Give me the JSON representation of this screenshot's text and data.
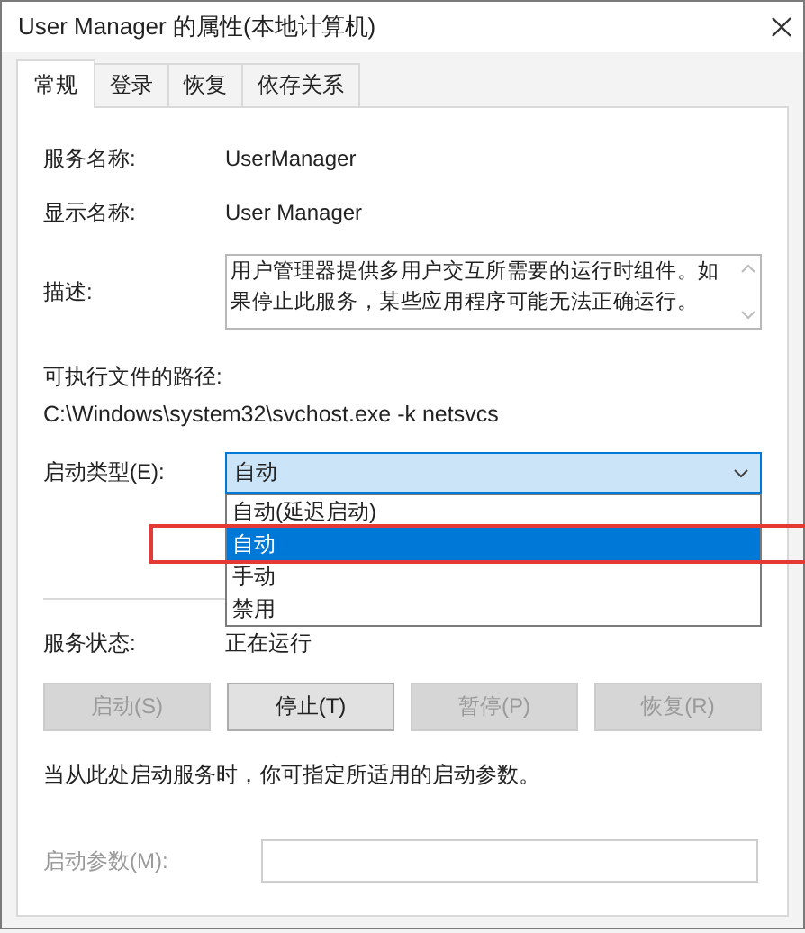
{
  "window": {
    "title": "User Manager 的属性(本地计算机)"
  },
  "tabs": [
    {
      "label": "常规",
      "selected": true
    },
    {
      "label": "登录",
      "selected": false
    },
    {
      "label": "恢复",
      "selected": false
    },
    {
      "label": "依存关系",
      "selected": false
    }
  ],
  "service_name": {
    "label": "服务名称:",
    "value": "UserManager"
  },
  "display_name": {
    "label": "显示名称:",
    "value": "User Manager"
  },
  "description": {
    "label": "描述:",
    "value": "用户管理器提供多用户交互所需要的运行时组件。如果停止此服务，某些应用程序可能无法正确运行。"
  },
  "executable_path": {
    "label": "可执行文件的路径:",
    "value": "C:\\Windows\\system32\\svchost.exe -k netsvcs"
  },
  "startup_type": {
    "label": "启动类型(E):",
    "value": "自动",
    "expanded": true,
    "options": [
      {
        "label": "自动(延迟启动)",
        "selected": false
      },
      {
        "label": "自动",
        "selected": true
      },
      {
        "label": "手动",
        "selected": false
      },
      {
        "label": "禁用",
        "selected": false
      }
    ]
  },
  "service_status": {
    "label": "服务状态:",
    "value": "正在运行"
  },
  "buttons": [
    {
      "label": "启动(S)",
      "disabled": true
    },
    {
      "label": "停止(T)",
      "disabled": false
    },
    {
      "label": "暂停(P)",
      "disabled": true
    },
    {
      "label": "恢复(R)",
      "disabled": true
    }
  ],
  "hint": "当从此处启动服务时，你可指定所适用的启动参数。",
  "start_parameters": {
    "label": "启动参数(M):",
    "disabled": true
  }
}
